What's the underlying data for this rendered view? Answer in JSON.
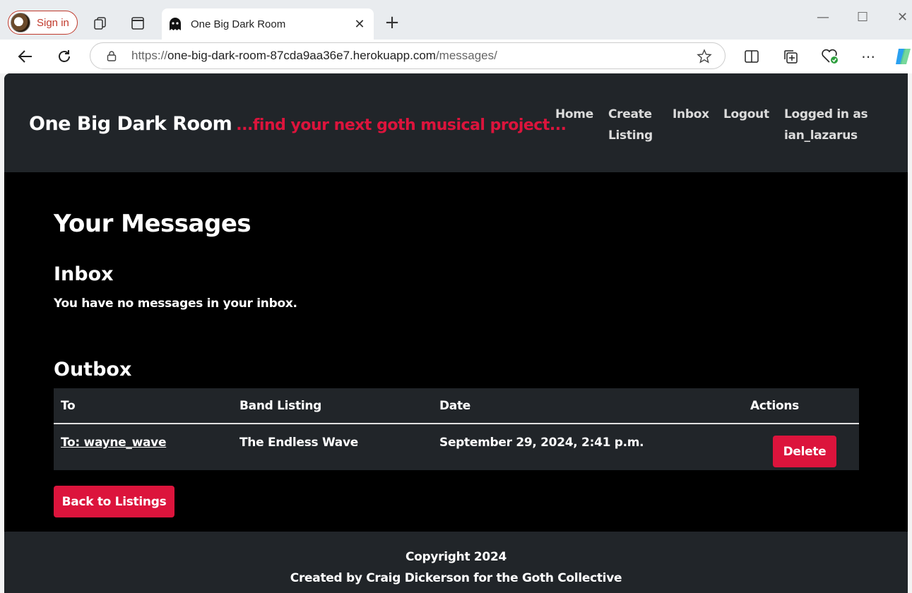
{
  "browser": {
    "signin_label": "Sign in",
    "tab_title": "One Big Dark Room",
    "url_scheme": "https://",
    "url_host": "one-big-dark-room-87cda9aa36e7.herokuapp.com",
    "url_path": "/messages/"
  },
  "nav": {
    "brand": "One Big Dark Room",
    "tagline": "...find your next goth musical project...",
    "home": "Home",
    "create_listing_1": "Create",
    "create_listing_2": "Listing",
    "inbox": "Inbox",
    "logout": "Logout",
    "logged_in_1": "Logged in as",
    "logged_in_2": "ian_lazarus"
  },
  "main": {
    "title": "Your Messages",
    "inbox_heading": "Inbox",
    "inbox_empty": "You have no messages in your inbox.",
    "outbox_heading": "Outbox",
    "columns": [
      "To",
      "Band Listing",
      "Date",
      "Actions"
    ],
    "rows": [
      {
        "to": "To: wayne_wave",
        "band": "The Endless Wave",
        "date": "September 29, 2024, 2:41 p.m.",
        "action": "Delete"
      }
    ],
    "back_button": "Back to Listings"
  },
  "footer": {
    "copyright": "Copyright 2024",
    "credit": "Created by Craig Dickerson for the Goth Collective"
  },
  "colors": {
    "accent": "#dc143c",
    "navbar_bg": "#212529",
    "page_bg": "#000000"
  }
}
